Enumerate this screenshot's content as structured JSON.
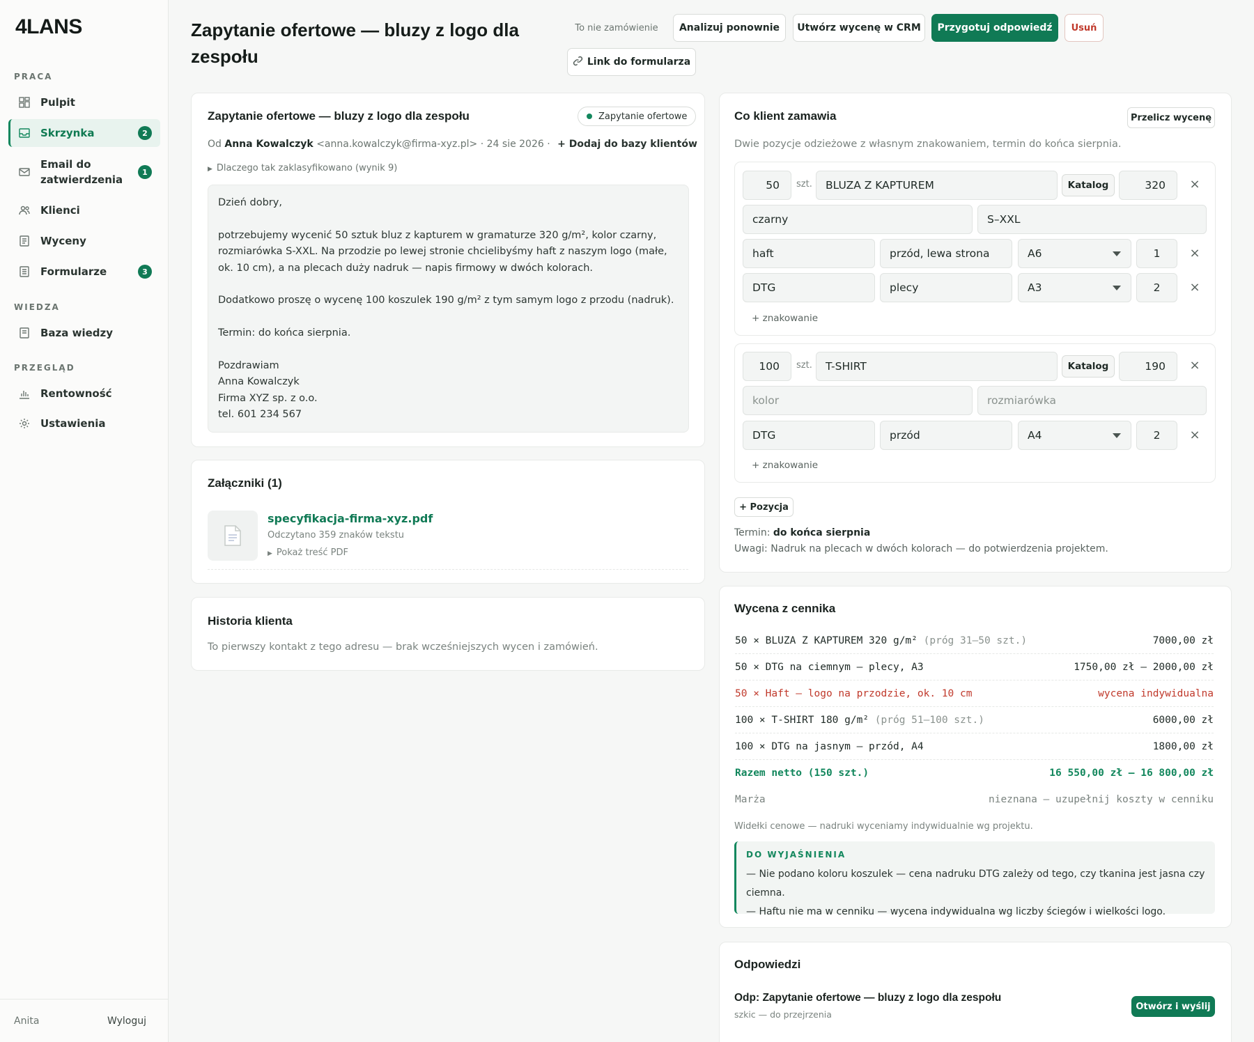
{
  "sidebar": {
    "logo": "4LANS",
    "sections": [
      "PRACA",
      "WIEDZA",
      "PRZEGLĄD"
    ],
    "items": [
      {
        "label": "Pulpit",
        "badge": ""
      },
      {
        "label": "Skrzynka",
        "badge": "2"
      },
      {
        "label": "Email do zatwierdzenia",
        "badge": "1"
      },
      {
        "label": "Klienci",
        "badge": ""
      },
      {
        "label": "Wyceny",
        "badge": ""
      },
      {
        "label": "Formularze",
        "badge": "3"
      },
      {
        "label": "Baza wiedzy",
        "badge": ""
      },
      {
        "label": "Rentowność",
        "badge": ""
      },
      {
        "label": "Ustawienia",
        "badge": ""
      }
    ],
    "user": "Anita",
    "logout": "Wyloguj"
  },
  "header": {
    "title": "Zapytanie ofertowe — bluzy z logo dla zespołu",
    "not_order": "To nie zamówienie",
    "reanalyze": "Analizuj ponownie",
    "create_crm": "Utwórz wycenę w CRM",
    "prepare": "Przygotuj odpowiedź",
    "delete": "Usuń",
    "form_link": "Link do formularza"
  },
  "email": {
    "title": "Zapytanie ofertowe — bluzy z logo dla zespołu",
    "tag": "Zapytanie ofertowe",
    "from_prefix": "Od",
    "from_name": "Anna Kowalczyk",
    "from_email": "<anna.kowalczyk@firma-xyz.pl>",
    "date": "· 24 sie 2026 ·",
    "add_client": "+ Dodaj do bazy klientów",
    "why": "Dlaczego tak zaklasyfikowano (wynik 9)",
    "body": "Dzień dobry,\n\npotrzebujemy wycenić 50 sztuk bluz z kapturem w gramaturze 320 g/m², kolor czarny, rozmiarówka S-XXL. Na przodzie po lewej stronie chcielibyśmy haft z naszym logo (małe, ok. 10 cm), a na plecach duży nadruk — napis firmowy w dwóch kolorach.\n\nDodatkowo proszę o wycenę 100 koszulek 190 g/m² z tym samym logo z przodu (nadruk).\n\nTermin: do końca sierpnia.\n\nPozdrawiam\nAnna Kowalczyk\nFirma XYZ sp. z o.o.\ntel. 601 234 567"
  },
  "attachments": {
    "title": "Załączniki (1)",
    "file": "specyfikacja-firma-xyz.pdf",
    "read": "Odczytano 359 znaków tekstu",
    "show": "Pokaż treść PDF"
  },
  "history": {
    "title": "Historia klienta",
    "text": "To pierwszy kontakt z tego adresu — brak wcześniejszych wycen i zamówień."
  },
  "order": {
    "title": "Co klient zamawia",
    "recalc": "Przelicz wycenę",
    "summary": "Dwie pozycje odzieżowe z własnym znakowaniem, termin do końca sierpnia.",
    "unit": "szt.",
    "catalog": "Katalog",
    "add_marking": "+ znakowanie",
    "add_position": "+ Pozycja",
    "items": [
      {
        "qty": "50",
        "name": "BLUZA Z KAPTUREM",
        "gsm": "320",
        "color": "czarny",
        "sizes": "S–XXL",
        "markings": [
          {
            "method": "haft",
            "place": "przód, lewa strona",
            "size": "A6",
            "colors": "1"
          },
          {
            "method": "DTG",
            "place": "plecy",
            "size": "A3",
            "colors": "2"
          }
        ]
      },
      {
        "qty": "100",
        "name": "T-SHIRT",
        "gsm": "190",
        "color_placeholder": "kolor",
        "sizes_placeholder": "rozmiarówka",
        "markings": [
          {
            "method": "DTG",
            "place": "przód",
            "size": "A4",
            "colors": "2"
          }
        ]
      }
    ],
    "term_label": "Termin:",
    "term": "do końca sierpnia",
    "notes": "Uwagi: Nadruk na plecach w dwóch kolorach — do potwierdzenia projektem."
  },
  "pricing": {
    "title": "Wycena z cennika",
    "rows": [
      {
        "left": "50 × BLUZA Z KAPTUREM 320 g/m²",
        "muted": "(próg 31–50 szt.)",
        "right": "7000,00 zł"
      },
      {
        "left": "50 × DTG na ciemnym — plecy, A3",
        "muted": "",
        "right": "1750,00 zł – 2000,00 zł"
      },
      {
        "left": "50 × Haft — logo na przodzie, ok. 10 cm",
        "muted": "",
        "right": "wycena indywidualna"
      },
      {
        "left": "100 × T-SHIRT 180 g/m²",
        "muted": "(próg 51–100 szt.)",
        "right": "6000,00 zł"
      },
      {
        "left": "100 × DTG na jasnym — przód, A4",
        "muted": "",
        "right": "1800,00 zł"
      }
    ],
    "total_label": "Razem netto (150 szt.)",
    "total_value": "16 550,00 zł – 16 800,00 zł",
    "margin_label": "Marża",
    "margin_value": "nieznana — uzupełnij koszty w cenniku",
    "footnote": "Widełki cenowe — nadruki wyceniamy indywidualnie wg projektu.",
    "note_title": "DO WYJAŚNIENIA",
    "note_lines": [
      "— Nie podano koloru koszulek — cena nadruku DTG zależy od tego, czy tkanina jest jasna czy ciemna.",
      "— Haftu nie ma w cenniku — wycena indywidualna wg liczby ściegów i wielkości logo."
    ],
    "accent": "#13875d",
    "warn": "#c0392b"
  },
  "replies": {
    "title": "Odpowiedzi",
    "subject": "Odp: Zapytanie ofertowe — bluzy z logo dla zespołu",
    "status": "szkic — do przejrzenia",
    "action": "Otwórz i wyślij"
  }
}
